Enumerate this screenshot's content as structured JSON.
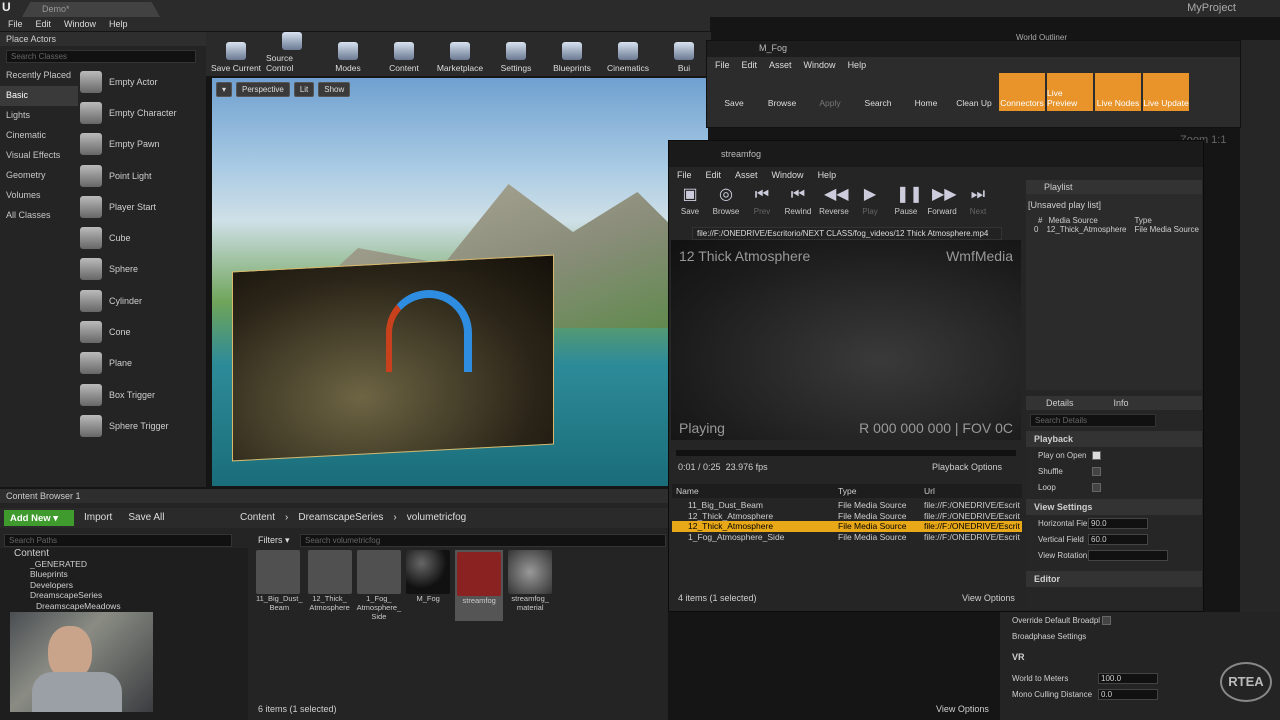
{
  "topbar": {
    "tab": "Demo*",
    "project": "MyProject"
  },
  "menu": [
    "File",
    "Edit",
    "Window",
    "Help"
  ],
  "place_actors": {
    "title": "Place Actors",
    "search_placeholder": "Search Classes",
    "categories": [
      "Recently Placed",
      "Basic",
      "Lights",
      "Cinematic",
      "Visual Effects",
      "Geometry",
      "Volumes",
      "All Classes"
    ],
    "items": [
      "Empty Actor",
      "Empty Character",
      "Empty Pawn",
      "Point Light",
      "Player Start",
      "Cube",
      "Sphere",
      "Cylinder",
      "Cone",
      "Plane",
      "Box Trigger",
      "Sphere Trigger"
    ]
  },
  "toolbar": [
    "Save Current",
    "Source Control",
    "Modes",
    "Content",
    "Marketplace",
    "Settings",
    "Blueprints",
    "Cinematics",
    "Bui"
  ],
  "viewport": {
    "perspective": "Perspective",
    "lit": "Lit",
    "show": "Show"
  },
  "world_outliner": "World Outliner",
  "content_browser": {
    "title": "Content Browser 1",
    "add_new": "Add New",
    "import": "Import",
    "save_all": "Save All",
    "path": [
      "Content",
      "DreamscapeSeries",
      "volumetricfog"
    ],
    "search_paths": "Search Paths",
    "filters": "Filters",
    "search_placeholder": "Search volumetricfog",
    "tree": [
      "Content",
      "_GENERATED",
      "Blueprints",
      "Developers",
      "DreamscapeSeries",
      "DreamscapeMeadows"
    ],
    "assets": [
      [
        "11_Big_Dust_",
        "Beam",
        ""
      ],
      [
        "12_Thick_",
        "Atmosphere",
        ""
      ],
      [
        "1_Fog_",
        "Atmosphere_",
        "Side"
      ],
      [
        "M_Fog",
        "",
        ""
      ],
      [
        "streamfog",
        "",
        ""
      ],
      [
        "streamfog_",
        "material",
        ""
      ]
    ],
    "count": "6 items (1 selected)",
    "view_options": "View Options"
  },
  "fog_window": {
    "tab": "M_Fog",
    "menu": [
      "File",
      "Edit",
      "Asset",
      "Window",
      "Help"
    ],
    "buttons": [
      "Save",
      "Browse",
      "Apply",
      "Search",
      "Home",
      "Clean Up",
      "Connectors",
      "Live Preview",
      "Live Nodes",
      "Live Update"
    ],
    "zoom": "Zoom 1:1"
  },
  "stream": {
    "tab": "streamfog",
    "menu": [
      "File",
      "Edit",
      "Asset",
      "Window",
      "Help"
    ],
    "buttons": [
      "Save",
      "Browse",
      "Prev",
      "Rewind",
      "Reverse",
      "Play",
      "Pause",
      "Forward",
      "Next"
    ],
    "url": "file://F:/ONEDRIVE/Escritorio/NEXT CLASS/fog_videos/12 Thick Atmosphere.mp4",
    "video_title": "12 Thick Atmosphere",
    "player": "WmfMedia",
    "status": "Playing",
    "overlay": "R 000 000 000 | FOV 0C",
    "time": "0:01 / 0:25",
    "fps": "23.976 fps",
    "playback_options": "Playback Options",
    "cols": [
      "Name",
      "Type",
      "Url"
    ],
    "rows": [
      [
        "11_Big_Dust_Beam",
        "File Media Source",
        "file://F:/ONEDRIVE/Escrit"
      ],
      [
        "12_Thick_Atmosphere",
        "File Media Source",
        "file://F:/ONEDRIVE/Escrit"
      ],
      [
        "12_Thick_Atmosphere",
        "File Media Source",
        "file://F:/ONEDRIVE/Escrit"
      ],
      [
        "1_Fog_Atmosphere_Side",
        "File Media Source",
        "file://F:/ONEDRIVE/Escrit"
      ]
    ],
    "count": "4 items (1 selected)",
    "view_options": "View Options",
    "playlist": {
      "title": "Playlist",
      "name": "[Unsaved play list]",
      "cols": [
        "#",
        "Media Source",
        "Type"
      ],
      "row": [
        "0",
        "12_Thick_Atmosphere",
        "File Media Source"
      ]
    },
    "details": {
      "tab1": "Details",
      "tab2": "Info",
      "search": "Search Details",
      "playback": "Playback",
      "play_on_open": "Play on Open",
      "shuffle": "Shuffle",
      "loop": "Loop",
      "view_settings": "View Settings",
      "hfov": "Horizontal Fie",
      "hfov_val": "90.0",
      "vfov": "Vertical Field",
      "vfov_val": "60.0",
      "rot": "View Rotation",
      "editor": "Editor"
    }
  },
  "right_panel": {
    "override": "Override Default Broadpl",
    "broadphase": "Broadphase Settings",
    "vr": "VR",
    "wtm": "World to Meters",
    "wtm_val": "100.0",
    "mono": "Mono Culling Distance",
    "mono_val": "0.0"
  },
  "logo": "RTEA"
}
